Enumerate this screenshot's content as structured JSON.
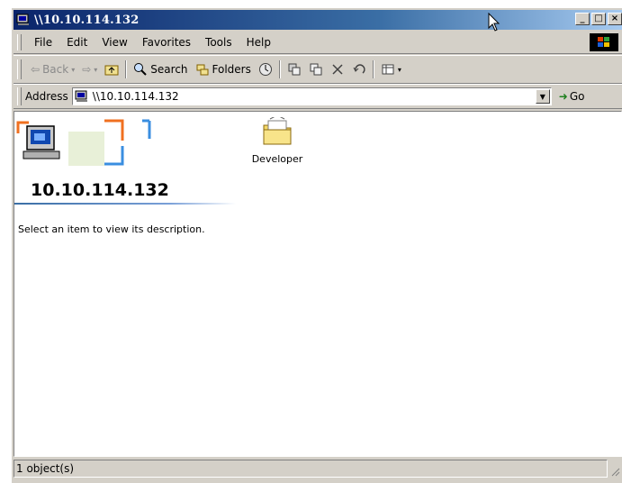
{
  "window": {
    "title": "\\\\10.10.114.132"
  },
  "title_controls": {
    "minimize": "_",
    "maximize": "□",
    "close": "×"
  },
  "menu": {
    "items": [
      "File",
      "Edit",
      "View",
      "Favorites",
      "Tools",
      "Help"
    ]
  },
  "toolbar": {
    "back_label": "Back",
    "search_label": "Search",
    "folders_label": "Folders"
  },
  "address": {
    "label": "Address",
    "value": "\\\\10.10.114.132",
    "go_label": "Go"
  },
  "content": {
    "host_title": "10.10.114.132",
    "description": "Select an item to view its description.",
    "items": [
      {
        "name": "Developer",
        "icon": "shared-folder-icon"
      }
    ]
  },
  "status": {
    "text": "1 object(s)"
  },
  "colors": {
    "titlebar_start": "#0a246a",
    "titlebar_end": "#a6caf0",
    "chrome": "#d4d0c8"
  }
}
